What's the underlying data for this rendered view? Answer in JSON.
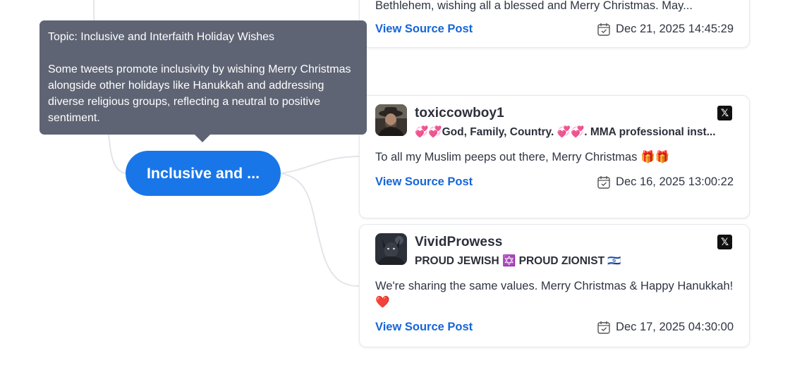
{
  "colors": {
    "accent": "#1976e8",
    "link": "#1565d8",
    "tooltip_bg": "#5f6474",
    "connector": "#e3e5ea"
  },
  "tooltip": {
    "title": "Topic: Inclusive and Interfaith Holiday Wishes",
    "body": "Some tweets promote inclusivity by wishing Merry Christmas alongside other holidays like Hanukkah and addressing diverse religious groups, reflecting a neutral to positive sentiment."
  },
  "topic_node": {
    "label": "Inclusive and ..."
  },
  "posts": [
    {
      "content": "Bethlehem, wishing all a blessed and Merry Christmas. May...",
      "link_label": "View Source Post",
      "date": "Dec 21, 2025 14:45:29",
      "platform_icon": "x-logo-icon"
    },
    {
      "username": "toxiccowboy1",
      "bio": "💞💞God, Family, Country. 💞💞. MMA professional inst...",
      "content": "To all my Muslim peeps out there, Merry Christmas 🎁🎁",
      "link_label": "View Source Post",
      "date": "Dec 16, 2025 13:00:22",
      "platform_icon": "x-logo-icon",
      "platform_glyph": "𝕏"
    },
    {
      "username": "VividProwess",
      "bio": "PROUD JEWISH ✡️ PROUD ZIONIST 🇮🇱",
      "content": "We're sharing the same values. Merry Christmas & Happy Hanukkah! ❤️",
      "link_label": "View Source Post",
      "date": "Dec 17, 2025 04:30:00",
      "platform_icon": "x-logo-icon",
      "platform_glyph": "𝕏"
    }
  ]
}
